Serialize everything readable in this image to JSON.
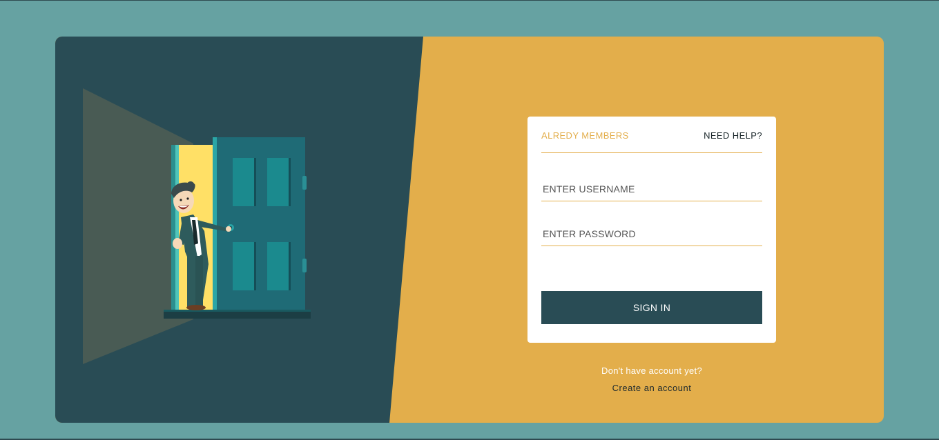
{
  "colors": {
    "page_background": "#66a2a2",
    "panel_dark": "#294c55",
    "panel_accent": "#e3ae4b",
    "card_background": "#ffffff"
  },
  "login": {
    "members_tab_label": "ALREDY MEMBERS",
    "help_link_label": "NEED HELP?",
    "username_placeholder": "ENTER USERNAME",
    "password_placeholder": "ENTER PASSWORD",
    "signin_label": "SIGN IN"
  },
  "footer": {
    "prompt_text": "Don't have account yet?",
    "create_link_label": "Create an account"
  },
  "illustration": {
    "icon": "man-opening-door-illustration"
  }
}
